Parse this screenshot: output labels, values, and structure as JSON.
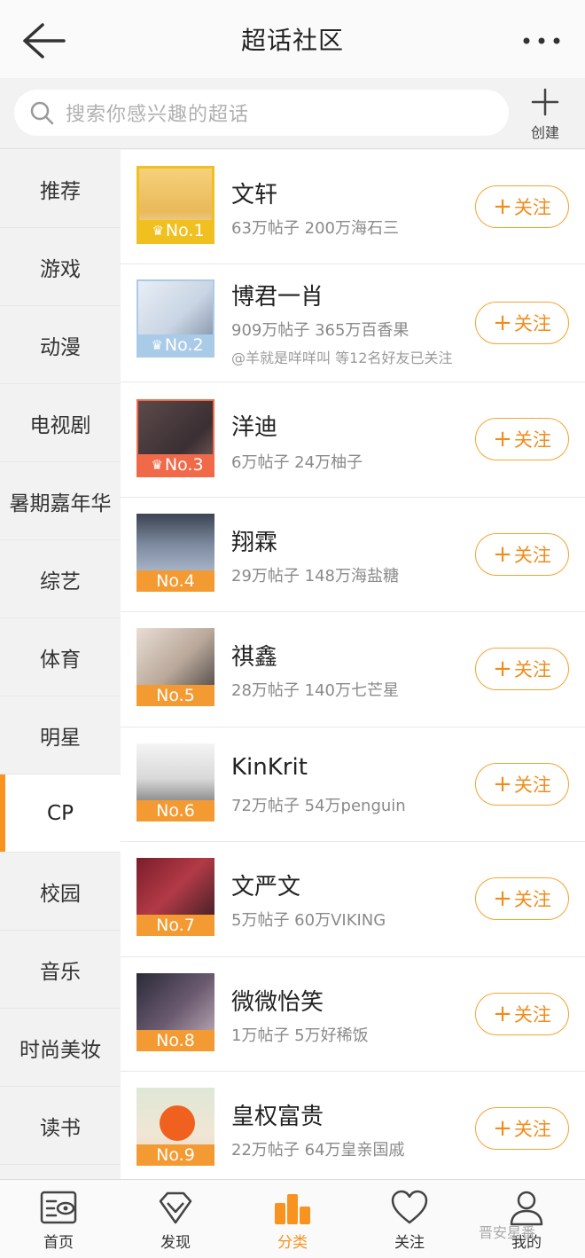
{
  "header": {
    "title": "超话社区"
  },
  "search": {
    "placeholder": "搜索你感兴趣的超话"
  },
  "create": {
    "label": "创建"
  },
  "sidebar": {
    "items": [
      {
        "label": "推荐"
      },
      {
        "label": "游戏"
      },
      {
        "label": "动漫"
      },
      {
        "label": "电视剧"
      },
      {
        "label": "暑期嘉年华"
      },
      {
        "label": "综艺"
      },
      {
        "label": "体育"
      },
      {
        "label": "明星"
      },
      {
        "label": "CP",
        "active": true
      },
      {
        "label": "校园"
      },
      {
        "label": "音乐"
      },
      {
        "label": "时尚美妆"
      },
      {
        "label": "读书"
      }
    ]
  },
  "follow_label": "关注",
  "list": [
    {
      "rank": "No.1",
      "name": "文轩",
      "stats": "63万帖子 200万海石三",
      "rank_color": "#f0c020",
      "crown": true
    },
    {
      "rank": "No.2",
      "name": "博君一肖",
      "stats": "909万帖子 365万百香果",
      "friends": "@羊就是咩咩叫 等12名好友已关注",
      "rank_color": "#a9cbe8",
      "crown": true
    },
    {
      "rank": "No.3",
      "name": "洋迪",
      "stats": "6万帖子 24万柚子",
      "rank_color": "#f06a4a",
      "crown": true
    },
    {
      "rank": "No.4",
      "name": "翔霖",
      "stats": "29万帖子 148万海盐糖",
      "rank_color": "#f39a32"
    },
    {
      "rank": "No.5",
      "name": "祺鑫",
      "stats": "28万帖子 140万七芒星",
      "rank_color": "#f39a32"
    },
    {
      "rank": "No.6",
      "name": "KinKrit",
      "stats": "72万帖子 54万penguin",
      "rank_color": "#f39a32"
    },
    {
      "rank": "No.7",
      "name": "文严文",
      "stats": "5万帖子 60万VIKING",
      "rank_color": "#f39a32"
    },
    {
      "rank": "No.8",
      "name": "微微怡笑",
      "stats": "1万帖子 5万好稀饭",
      "rank_color": "#f39a32"
    },
    {
      "rank": "No.9",
      "name": "皇权富贵",
      "stats": "22万帖子 64万皇亲国戚",
      "rank_color": "#f39a32"
    }
  ],
  "bottom_nav": [
    {
      "label": "首页",
      "icon": "home-icon"
    },
    {
      "label": "发现",
      "icon": "diamond-icon"
    },
    {
      "label": "分类",
      "icon": "category-icon",
      "active": true
    },
    {
      "label": "关注",
      "icon": "heart-icon"
    },
    {
      "label": "我的",
      "icon": "profile-icon"
    }
  ],
  "watermark": "晋安星番",
  "colors": {
    "accent": "#f7931e",
    "follow_border": "#f3a433"
  }
}
